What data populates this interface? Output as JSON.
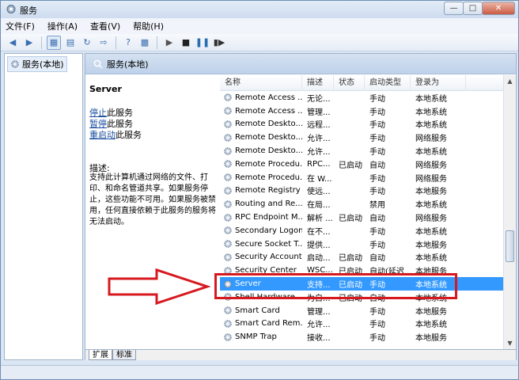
{
  "window": {
    "title": "服务"
  },
  "menu": [
    "文件(F)",
    "操作(A)",
    "查看(V)",
    "帮助(H)"
  ],
  "tree": {
    "root": "服务(本地)"
  },
  "pane": {
    "header": "服务(本地)"
  },
  "description": {
    "service_name": "Server",
    "stop": "停止",
    "stop_suffix": "此服务",
    "pause": "暂停",
    "pause_suffix": "此服务",
    "restart": "重启动",
    "restart_suffix": "此服务",
    "label": "描述:",
    "text": "支持此计算机通过网络的文件、打印、和命名管道共享。如果服务停止，这些功能不可用。如果服务被禁用，任何直接依赖于此服务的服务将无法启动。"
  },
  "columns": [
    "名称",
    "描述",
    "状态",
    "启动类型",
    "登录为"
  ],
  "rows": [
    {
      "name": "Remote Access ...",
      "desc": "无论...",
      "status": "",
      "startup": "手动",
      "logon": "本地系统"
    },
    {
      "name": "Remote Access ...",
      "desc": "管理...",
      "status": "",
      "startup": "手动",
      "logon": "本地系统"
    },
    {
      "name": "Remote Deskto...",
      "desc": "远程...",
      "status": "",
      "startup": "手动",
      "logon": "本地系统"
    },
    {
      "name": "Remote Deskto...",
      "desc": "允许...",
      "status": "",
      "startup": "手动",
      "logon": "网络服务"
    },
    {
      "name": "Remote Deskto...",
      "desc": "允许...",
      "status": "",
      "startup": "手动",
      "logon": "本地系统"
    },
    {
      "name": "Remote Procedu...",
      "desc": "RPC...",
      "status": "已启动",
      "startup": "自动",
      "logon": "网络服务"
    },
    {
      "name": "Remote Procedu...",
      "desc": "在 W...",
      "status": "",
      "startup": "手动",
      "logon": "网络服务"
    },
    {
      "name": "Remote Registry",
      "desc": "使远...",
      "status": "",
      "startup": "手动",
      "logon": "本地服务"
    },
    {
      "name": "Routing and Re...",
      "desc": "在局...",
      "status": "",
      "startup": "禁用",
      "logon": "本地系统"
    },
    {
      "name": "RPC Endpoint M...",
      "desc": "解析 ...",
      "status": "已启动",
      "startup": "自动",
      "logon": "网络服务"
    },
    {
      "name": "Secondary Logon",
      "desc": "在不...",
      "status": "",
      "startup": "手动",
      "logon": "本地系统"
    },
    {
      "name": "Secure Socket T...",
      "desc": "提供...",
      "status": "",
      "startup": "手动",
      "logon": "本地服务"
    },
    {
      "name": "Security Account...",
      "desc": "启动...",
      "status": "已启动",
      "startup": "自动",
      "logon": "本地系统"
    },
    {
      "name": "Security Center",
      "desc": "WSC...",
      "status": "已启动",
      "startup": "自动(延迟...",
      "logon": "本地服务"
    },
    {
      "name": "Server",
      "desc": "支持...",
      "status": "已启动",
      "startup": "手动",
      "logon": "本地系统",
      "selected": true
    },
    {
      "name": "Shell Hardware ...",
      "desc": "为自...",
      "status": "已启动",
      "startup": "自动",
      "logon": "本地系统"
    },
    {
      "name": "Smart Card",
      "desc": "管理...",
      "status": "",
      "startup": "手动",
      "logon": "本地服务"
    },
    {
      "name": "Smart Card Rem...",
      "desc": "允许...",
      "status": "",
      "startup": "手动",
      "logon": "本地系统"
    },
    {
      "name": "SNMP Trap",
      "desc": "接收...",
      "status": "",
      "startup": "手动",
      "logon": "本地服务"
    }
  ],
  "tabs": [
    "扩展",
    "标准"
  ]
}
